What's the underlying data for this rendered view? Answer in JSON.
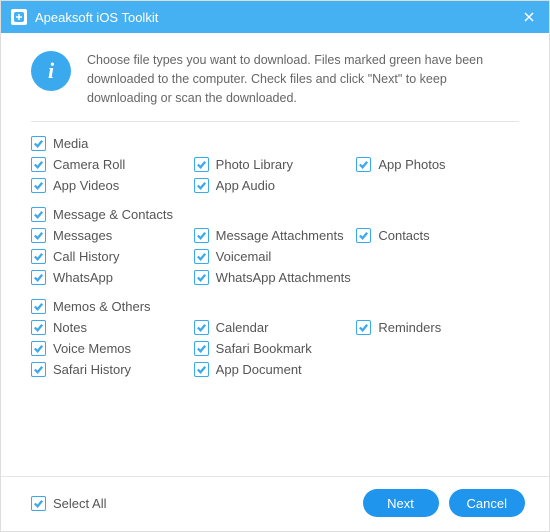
{
  "titlebar": {
    "title": "Apeaksoft iOS Toolkit"
  },
  "intro": "Choose file types you want to download. Files marked green have been downloaded to the computer. Check files and click \"Next\" to keep downloading or scan the downloaded.",
  "info_glyph": "i",
  "sections": {
    "media": {
      "header": "Media",
      "items": [
        "Camera Roll",
        "Photo Library",
        "App Photos",
        "App Videos",
        "App Audio"
      ]
    },
    "contacts": {
      "header": "Message & Contacts",
      "items": [
        "Messages",
        "Message Attachments",
        "Contacts",
        "Call History",
        "Voicemail",
        "WhatsApp",
        "WhatsApp Attachments"
      ]
    },
    "memos": {
      "header": "Memos & Others",
      "items": [
        "Notes",
        "Calendar",
        "Reminders",
        "Voice Memos",
        "Safari Bookmark",
        "Safari History",
        "App Document"
      ]
    }
  },
  "select_all": "Select All",
  "buttons": {
    "next": "Next",
    "cancel": "Cancel"
  }
}
